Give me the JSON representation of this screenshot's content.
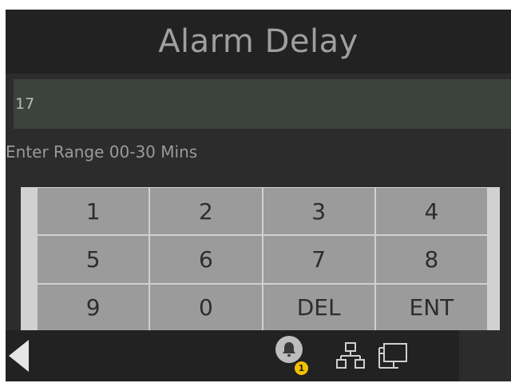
{
  "header": {
    "title": "Alarm Delay"
  },
  "input": {
    "value": "17"
  },
  "hint": "Enter Range 00-30 Mins",
  "keypad": {
    "keys": [
      {
        "name": "key-1",
        "label": "1"
      },
      {
        "name": "key-2",
        "label": "2"
      },
      {
        "name": "key-3",
        "label": "3"
      },
      {
        "name": "key-4",
        "label": "4"
      },
      {
        "name": "key-5",
        "label": "5"
      },
      {
        "name": "key-6",
        "label": "6"
      },
      {
        "name": "key-7",
        "label": "7"
      },
      {
        "name": "key-8",
        "label": "8"
      },
      {
        "name": "key-9",
        "label": "9"
      },
      {
        "name": "key-0",
        "label": "0"
      },
      {
        "name": "delete-key",
        "label": "DEL"
      },
      {
        "name": "enter-key",
        "label": "ENT"
      }
    ]
  },
  "footer": {
    "back_icon": "back-arrow-icon",
    "alarm_icon": "bell-icon",
    "alarm_badge": "1",
    "network_icon": "network-icon",
    "device_icon": "computer-icon"
  },
  "colors": {
    "background": "#2c2c2c",
    "bar": "#222222",
    "input": "#3c433e",
    "key": "#9b9b9b",
    "badge": "#f2c200"
  }
}
